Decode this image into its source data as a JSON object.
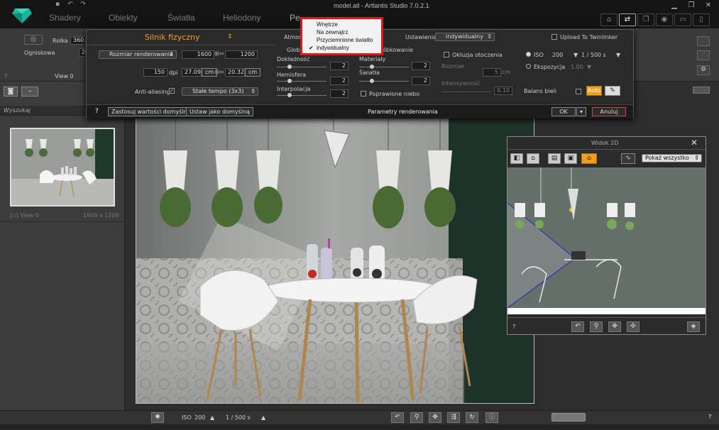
{
  "window": {
    "title": "model.atl - Artlantis Studio 7.0.2.1"
  },
  "nav_tabs": [
    "Shadery",
    "Obiekty",
    "Światła",
    "Heliodony",
    "Pe"
  ],
  "toolbar": {
    "roll_label": "Rolka",
    "roll_value": "360.",
    "focal_label": "Ogniskowa",
    "focal_value": "26",
    "view_label": "View 0"
  },
  "render_dialog": {
    "engine_label": "Silnik fizyczny",
    "atmosphere_label": "Atmos",
    "settings_label": "Ustawienia",
    "settings_value": "indywidualny",
    "upload_label": "Upload To Twinlinker",
    "render_size_label": "Rozmiar renderowania",
    "width_value": "1600",
    "height_value": "1200",
    "dpi_value": "150",
    "dpi_unit": "dpi",
    "size_w_cm": "27.09",
    "size_unit": "cm",
    "size_h_cm": "20.32",
    "global_label": "Glob",
    "precision_label": "Dokładność",
    "precision_value": "2",
    "hemisphere_label": "Hemisfera",
    "hemisphere_value": "2",
    "interpolation_label": "Interpolacja",
    "interpolation_value": "2",
    "sampling_label": "óbkowanie",
    "materials_label": "Materiały",
    "materials_value": "2",
    "lights_label": "Światła",
    "lights_value": "2",
    "improved_sky_label": "Poprawione niebo",
    "ao_label": "Okluzja otoczenia",
    "ao_size_label": "Rozmiar",
    "ao_size_value": "5",
    "ao_size_unit": "cm",
    "ao_intensity_label": "Intensywność",
    "ao_intensity_value": "0.10",
    "iso_label": "ISO",
    "iso_value": "200",
    "shutter_value": "1 / 500 s",
    "exposure_label": "Ekspozycja",
    "exposure_value": "1.00",
    "white_balance_label": "Balans bieli",
    "auto_label": "Auto",
    "antialias_label": "Anti-aliasing",
    "antialias_value": "Stałe tempo (3x3)",
    "help_label": "?",
    "apply_defaults_label": "Zastosuj wartości domyślne",
    "set_default_label": "Ustaw jako domyślną",
    "dialog_caption": "Parametry renderowania",
    "ok_label": "OK",
    "cancel_label": "Anuluj"
  },
  "atmosphere_menu": {
    "items": [
      {
        "label": "Wnętrze",
        "checked": false
      },
      {
        "label": "Na zewnątrz",
        "checked": false
      },
      {
        "label": "Przyciemnione światło",
        "checked": false
      },
      {
        "label": "indywidualny",
        "checked": true
      }
    ]
  },
  "left_panel": {
    "search_placeholder": "Wyszukaj",
    "view_name": "View 0",
    "view_size": "1600 x 1200",
    "help": "?"
  },
  "view2d": {
    "title": "Widok 2D",
    "show_all": "Pokaż wszystko",
    "help": "?"
  },
  "bottom_bar": {
    "iso_label": "ISO",
    "iso_value": "200",
    "shutter_value": "1 / 500 s",
    "help": "?"
  },
  "colors": {
    "accent_orange": "#f0a020",
    "menu_border": "#e01818",
    "engine_text": "#f0a020"
  }
}
